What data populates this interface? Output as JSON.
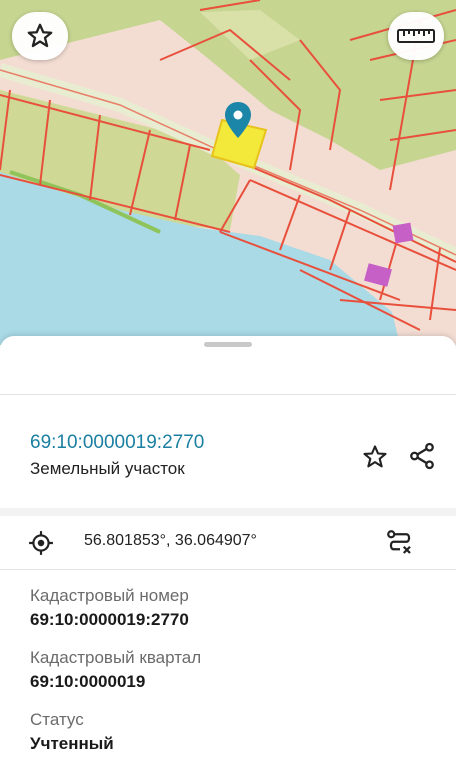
{
  "map": {
    "icons": {
      "favorite": "star-outline-icon",
      "ruler": "ruler-icon",
      "marker": "map-pin-icon"
    }
  },
  "card": {
    "cadastral_link": "69:10:0000019:2770",
    "object_type": "Земельный участок",
    "coordinates": "56.801853°, 36.064907°"
  },
  "details": [
    {
      "label": "Кадастровый номер",
      "value": "69:10:0000019:2770"
    },
    {
      "label": "Кадастровый квартал",
      "value": "69:10:0000019"
    },
    {
      "label": "Статус",
      "value": "Учтенный"
    }
  ],
  "colors": {
    "accent": "#1b7fa1",
    "parcel_border": "#e8503c",
    "water": "#a9dae6",
    "forest": "#c6d590",
    "selected": "#f2e93a"
  }
}
